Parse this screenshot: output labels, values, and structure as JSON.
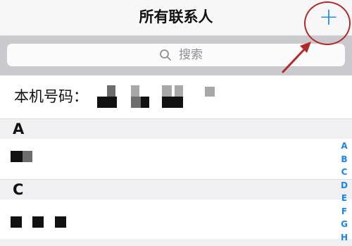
{
  "navbar": {
    "title": "所有联系人",
    "add_label": "+"
  },
  "search": {
    "icon": "search-icon",
    "placeholder": "搜索"
  },
  "my_number": {
    "label": "本机号码："
  },
  "sections": [
    {
      "letter": "A"
    },
    {
      "letter": "C"
    }
  ],
  "index_letters": [
    "A",
    "B",
    "C",
    "D",
    "E",
    "F",
    "G",
    "H"
  ],
  "colors": {
    "accent": "#1a84f5",
    "annotation": "#b22a2a",
    "search_bar_bg": "#c9c9ce",
    "section_bg": "#f0f0f3"
  }
}
